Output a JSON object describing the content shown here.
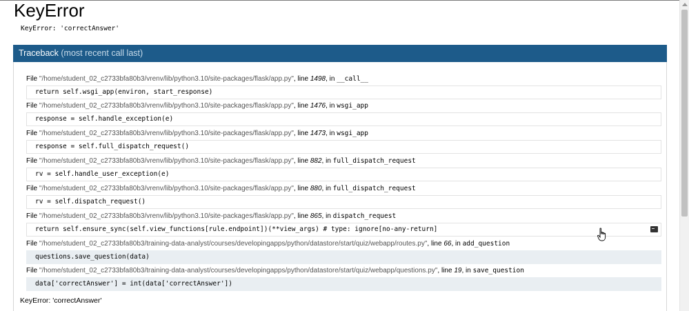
{
  "page": {
    "title": "KeyError",
    "error_message": "KeyError: 'correctAnswer'"
  },
  "traceback": {
    "header": "Traceback",
    "header_sub": "(most recent call last)",
    "frames": [
      {
        "file": "\"/home/student_02_c2733bfa80b3/vrenv/lib/python3.10/site-packages/flask/app.py\"",
        "line": "1498",
        "func": "__call__",
        "code": "return self.wsgi_app(environ, start_response)"
      },
      {
        "file": "\"/home/student_02_c2733bfa80b3/vrenv/lib/python3.10/site-packages/flask/app.py\"",
        "line": "1476",
        "func": "wsgi_app",
        "code": "response = self.handle_exception(e)"
      },
      {
        "file": "\"/home/student_02_c2733bfa80b3/vrenv/lib/python3.10/site-packages/flask/app.py\"",
        "line": "1473",
        "func": "wsgi_app",
        "code": "response = self.full_dispatch_request()"
      },
      {
        "file": "\"/home/student_02_c2733bfa80b3/vrenv/lib/python3.10/site-packages/flask/app.py\"",
        "line": "882",
        "func": "full_dispatch_request",
        "code": "rv = self.handle_user_exception(e)"
      },
      {
        "file": "\"/home/student_02_c2733bfa80b3/vrenv/lib/python3.10/site-packages/flask/app.py\"",
        "line": "880",
        "func": "full_dispatch_request",
        "code": "rv = self.dispatch_request()"
      },
      {
        "file": "\"/home/student_02_c2733bfa80b3/vrenv/lib/python3.10/site-packages/flask/app.py\"",
        "line": "865",
        "func": "dispatch_request",
        "code": "return self.ensure_sync(self.view_functions[rule.endpoint])(**view_args)  # type: ignore[no-any-return]"
      },
      {
        "file": "\"/home/student_02_c2733bfa80b3/training-data-analyst/courses/developingapps/python/datastore/start/quiz/webapp/routes.py\"",
        "line": "66",
        "func": "add_question",
        "code": "questions.save_question(data)"
      },
      {
        "file": "\"/home/student_02_c2733bfa80b3/training-data-analyst/courses/developingapps/python/datastore/start/quiz/webapp/questions.py\"",
        "line": "19",
        "func": "save_question",
        "code": "data['correctAnswer'] = int(data['correctAnswer'])"
      }
    ],
    "labels": {
      "file": "File",
      "line": "line",
      "in": "in"
    }
  },
  "footer": {
    "error": "KeyError: 'correctAnswer'"
  },
  "icons": {
    "console": "console-icon",
    "cursor": "hand-pointer-icon"
  },
  "colors": {
    "header_bg": "#1d5b8a",
    "app_frame_bg": "#e9eef2"
  }
}
